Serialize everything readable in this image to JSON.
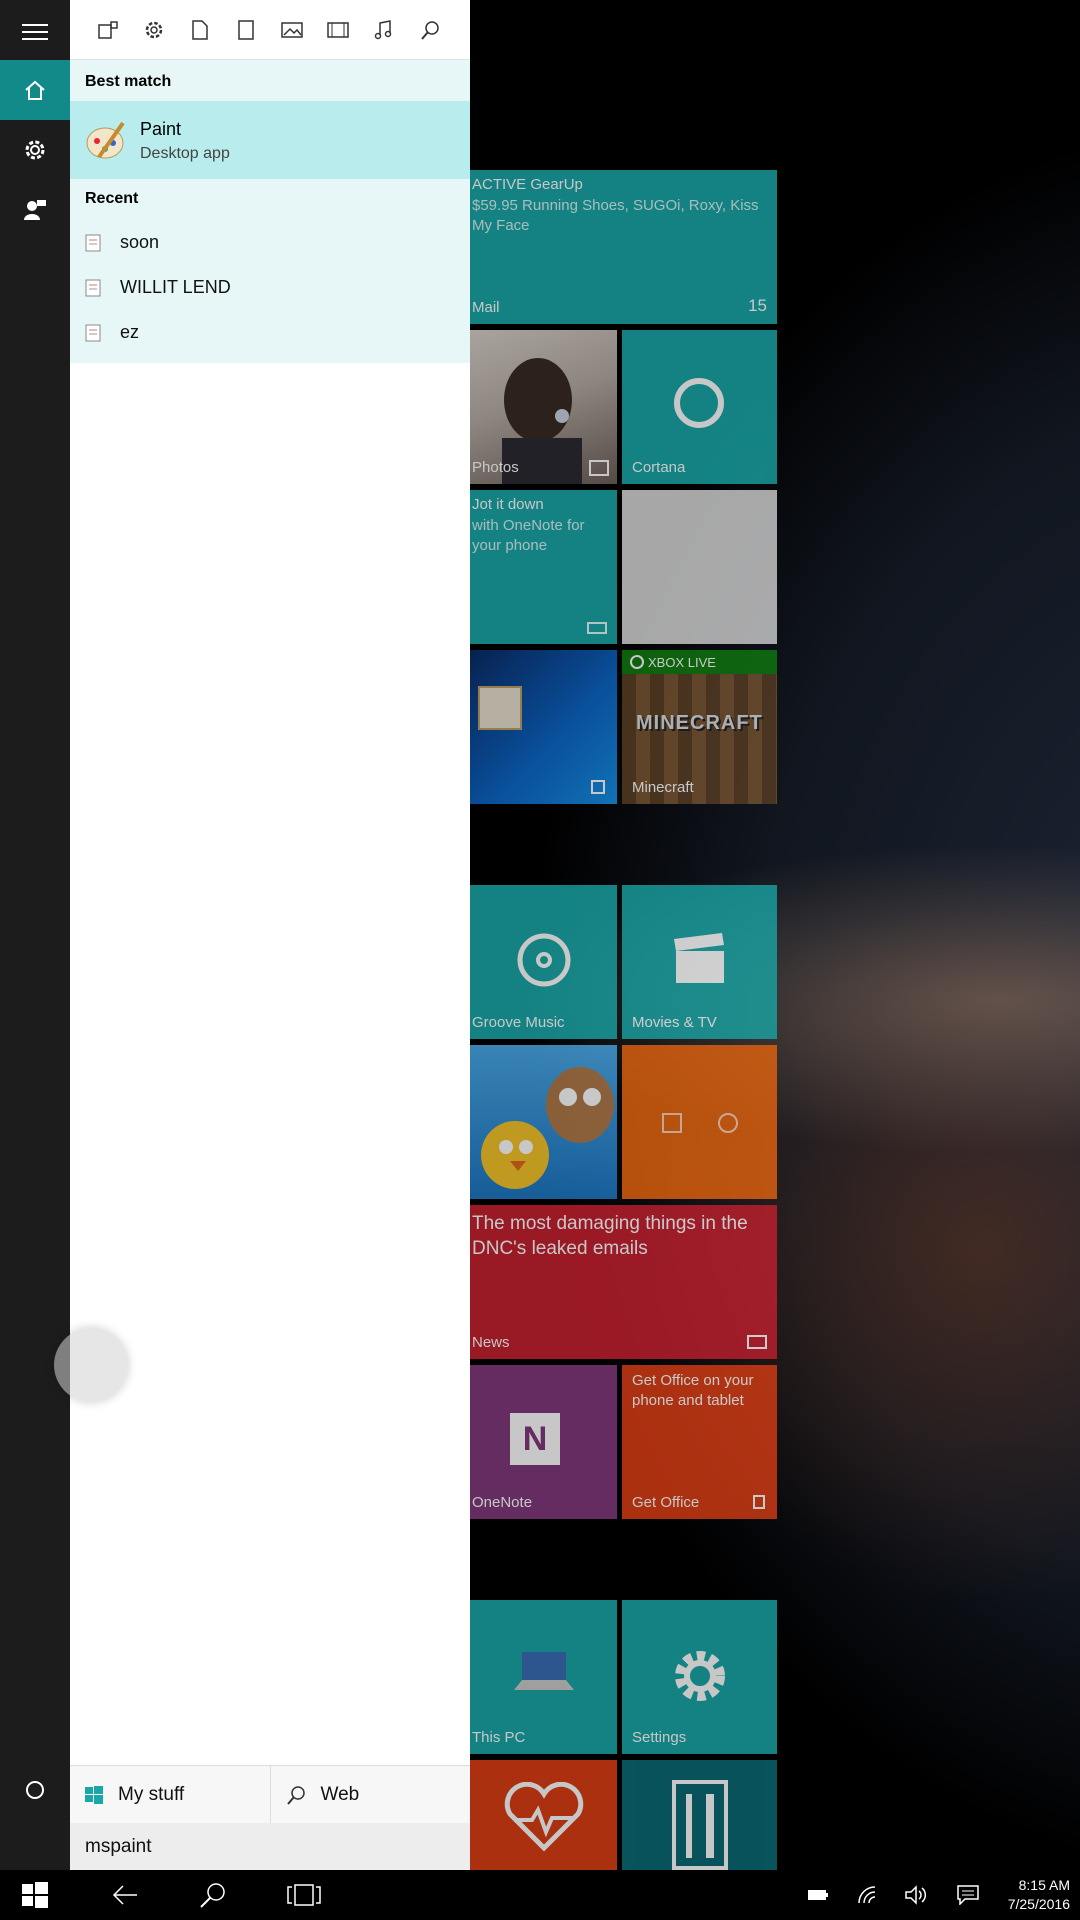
{
  "colors": {
    "accent": "#1aa7a7",
    "rail": "#1c1c1c",
    "rail_active": "#138a8a",
    "best_match_bg": "#b9eded",
    "results_bg": "#e7f7f7"
  },
  "rail": {
    "icons": [
      "hamburger-icon",
      "home-icon",
      "settings-icon",
      "feedback-icon"
    ],
    "bottom_icon": "cortana-circle-icon"
  },
  "filters": {
    "icons": [
      "apps-filter-icon",
      "settings-filter-icon",
      "documents-filter-icon",
      "folders-filter-icon",
      "photos-filter-icon",
      "videos-filter-icon",
      "music-filter-icon",
      "web-filter-icon"
    ]
  },
  "best_match": {
    "header": "Best match",
    "title": "Paint",
    "subtitle": "Desktop app",
    "icon": "paint-app-icon"
  },
  "recent": {
    "header": "Recent",
    "items": [
      "soon",
      "WILLIT LEND",
      "ez"
    ]
  },
  "scopes": {
    "my_stuff": "My stuff",
    "web": "Web"
  },
  "search": {
    "query": "mspaint"
  },
  "tiles": {
    "mail": {
      "line1": "ACTIVE GearUp",
      "line2": "$59.95 Running Shoes, SUGOi, Roxy, Kiss My Face",
      "label": "Mail",
      "count": "15"
    },
    "photos": {
      "label": "Photos"
    },
    "cortana": {
      "label": "Cortana"
    },
    "onenote_jot": {
      "line1": "Jot it down",
      "line2": "with OneNote for your phone"
    },
    "xbox": {
      "badge": "XBOX LIVE"
    },
    "minecraft": {
      "label": "Minecraft",
      "logo": "MINECRAFT"
    },
    "groove": {
      "label": "Groove Music"
    },
    "movies": {
      "label": "Movies & TV"
    },
    "news": {
      "headline": "The most damaging things in the DNC's leaked emails",
      "label": "News"
    },
    "onenote": {
      "label": "OneNote"
    },
    "office": {
      "text": "Get Office on your phone and tablet",
      "label": "Get Office"
    },
    "thispc": {
      "label": "This PC"
    },
    "settings": {
      "label": "Settings"
    }
  },
  "taskbar": {
    "time": "8:15 AM",
    "date": "7/25/2016"
  }
}
